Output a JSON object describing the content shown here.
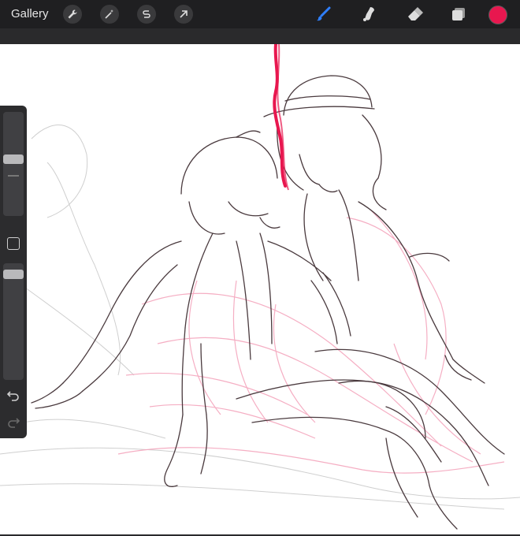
{
  "toolbar": {
    "gallery_label": "Gallery",
    "left_tools": [
      "wrench-icon",
      "magic-wand-icon",
      "selection-s-icon",
      "arrow-transform-icon"
    ],
    "right_tools": [
      "brush-icon",
      "smudge-icon",
      "eraser-icon",
      "layers-icon"
    ],
    "active_tool": "brush-icon",
    "active_color": "#e8174f",
    "accent_color": "#2f7fff"
  },
  "sidebar": {
    "brush_size_level": 0.55,
    "opacity_level": 0.9,
    "tools": [
      "modify-square-icon",
      "undo-icon",
      "redo-icon"
    ]
  },
  "canvas": {
    "background": "#ffffff",
    "sketch_line_color": "#4a3a3e",
    "sketch_underlay_color": "#f4a6bd",
    "stroke_color": "#e8174f"
  }
}
